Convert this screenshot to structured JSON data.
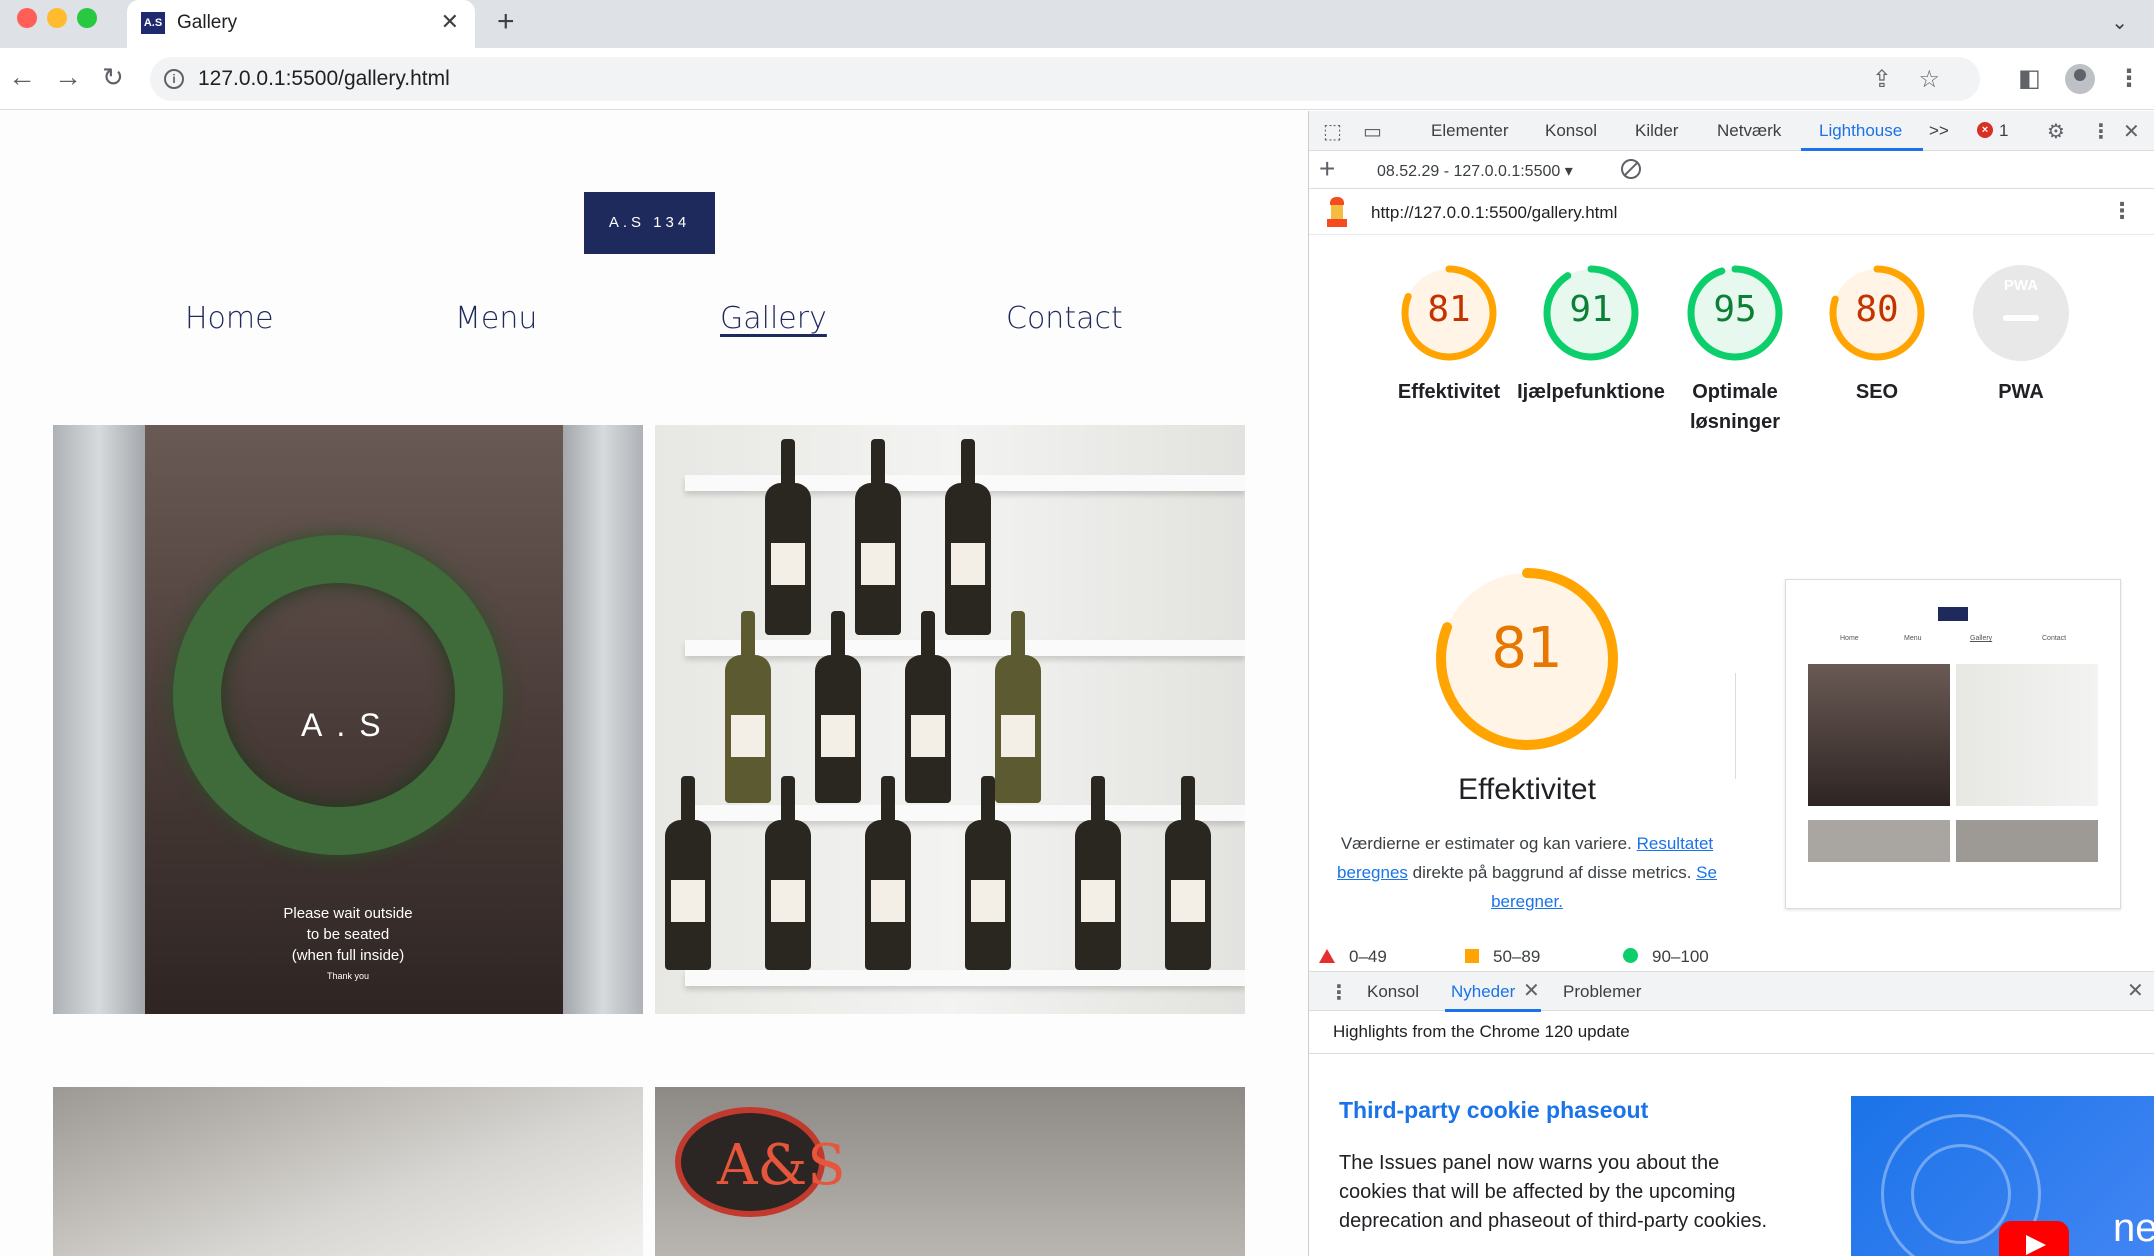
{
  "browser": {
    "tab_title": "Gallery",
    "favicon_text": "A.S",
    "url": "127.0.0.1:5500/gallery.html"
  },
  "site": {
    "logo_text": "A.S 134",
    "nav": [
      "Home",
      "Menu",
      "Gallery",
      "Contact"
    ],
    "active_nav": "Gallery",
    "door_sign": "A.S",
    "door_note": [
      "Please wait outside",
      "to be seated",
      "(when full inside)",
      "Thank you"
    ],
    "neon_sign": "A&S"
  },
  "devtools": {
    "tabs": [
      "Elementer",
      "Konsol",
      "Kilder",
      "Netværk",
      "Lighthouse"
    ],
    "active_tab": "Lighthouse",
    "more_tabs": ">>",
    "error_count": "1",
    "report_selector": "08.52.29 - 127.0.0.1:5500",
    "lighthouse": {
      "url": "http://127.0.0.1:5500/gallery.html",
      "scores": [
        {
          "label": "Effektivitet",
          "value": 81,
          "status": "average"
        },
        {
          "label": "Ijælpefunktione",
          "value": 91,
          "status": "pass"
        },
        {
          "label": "Optimale løsninger",
          "value": 95,
          "status": "pass"
        },
        {
          "label": "SEO",
          "value": 80,
          "status": "average"
        },
        {
          "label": "PWA",
          "value": null,
          "status": "na"
        }
      ],
      "pwa_badge": "PWA",
      "main_score": 81,
      "main_title": "Effektivitet",
      "desc_prefix": "Værdierne er estimater og kan variere.",
      "desc_link1": "Resultatet beregnes",
      "desc_mid": "direkte på baggrund af disse metrics.",
      "desc_link2": "Se beregner.",
      "legend": [
        "0–49",
        "50–89",
        "90–100"
      ],
      "thumb_nav": [
        "Home",
        "Menu",
        "Gallery",
        "Contact"
      ]
    },
    "drawer": {
      "tabs": [
        "Konsol",
        "Nyheder",
        "Problemer"
      ],
      "active_tab": "Nyheder",
      "headline": "Highlights from the Chrome 120 update",
      "news_title": "Third-party cookie phaseout",
      "news_body": "The Issues panel now warns you about the cookies that will be affected by the upcoming deprecation and phaseout of third-party cookies.",
      "news_image_text": "ne"
    }
  },
  "colors": {
    "brand_navy": "#1f2a5c",
    "score_average": "#ffa400",
    "score_pass": "#0cce6b",
    "score_fail": "#e62e2e",
    "link_blue": "#1a73e8"
  }
}
